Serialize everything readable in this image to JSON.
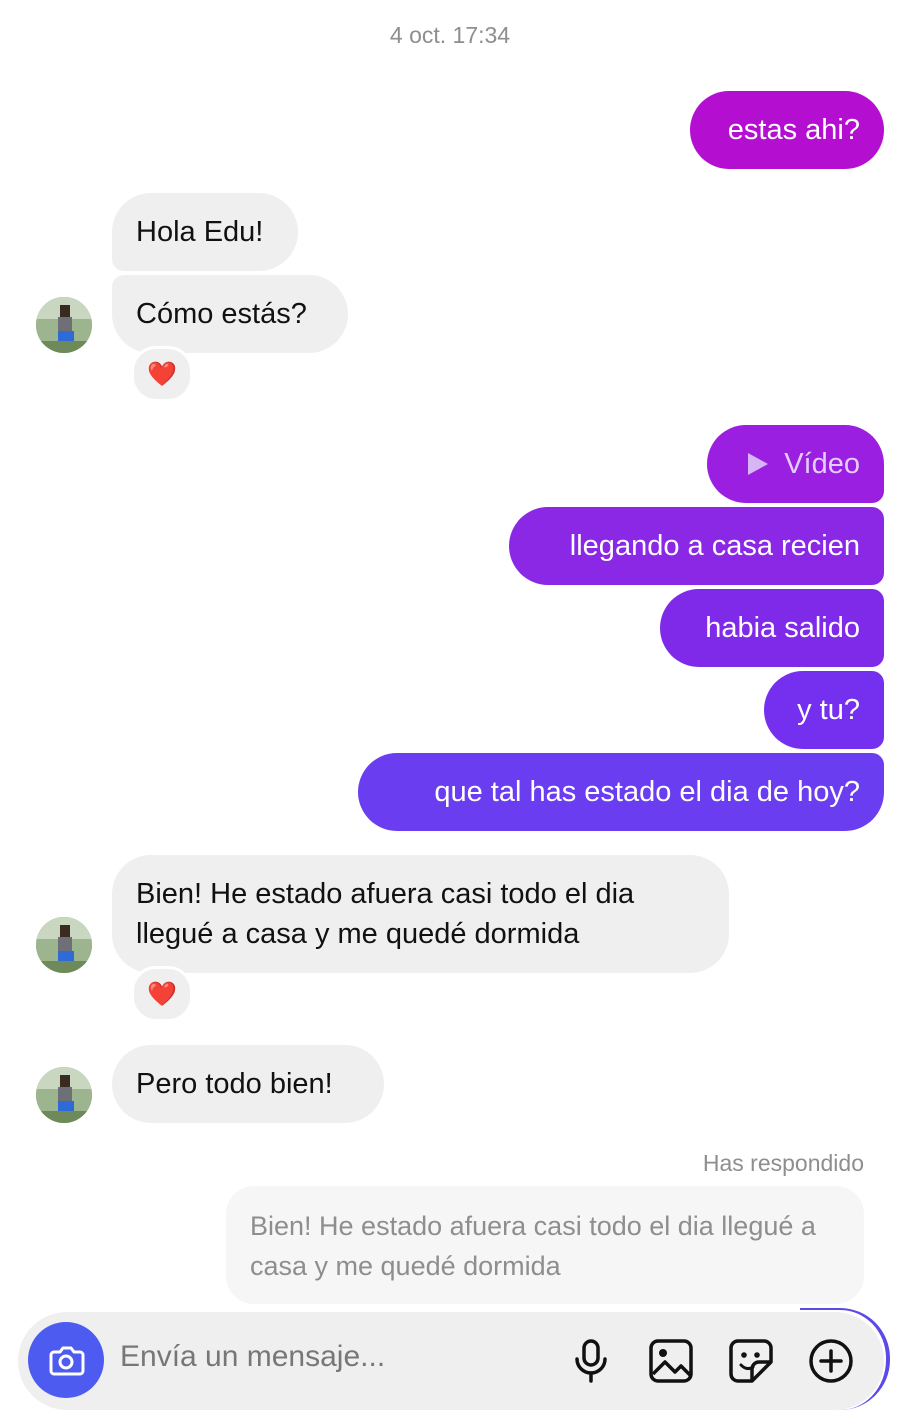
{
  "timestamp": "4 oct. 17:34",
  "messages": {
    "out1": "estas ahi?",
    "in1": "Hola Edu!",
    "in2": "Cómo estás?",
    "video": "Vídeo",
    "out2": "llegando a casa recien",
    "out3": "habia salido",
    "out4": "y tu?",
    "out5": "que tal has estado el dia de hoy?",
    "in3": "Bien! He estado afuera casi todo el dia llegué a casa y me quedé dormida",
    "in4": "Pero todo bien!"
  },
  "reactions": {
    "emoji": "❤️"
  },
  "reply": {
    "label": "Has respondido",
    "quoted": "Bien! He estado afuera casi todo el dia llegué a casa y me quedé dormida"
  },
  "composer": {
    "placeholder": "Envía un mensaje..."
  },
  "colors": {
    "incoming_bg": "#efefef",
    "outgoing_magenta": "#b40ed0",
    "outgoing_purple": "#7f2ae0",
    "outgoing_indigo": "#6a3ef0",
    "camera_button": "#4d5bf0"
  },
  "icons": [
    "camera-icon",
    "microphone-icon",
    "gallery-icon",
    "sticker-icon",
    "plus-icon",
    "play-icon",
    "heart-icon"
  ]
}
